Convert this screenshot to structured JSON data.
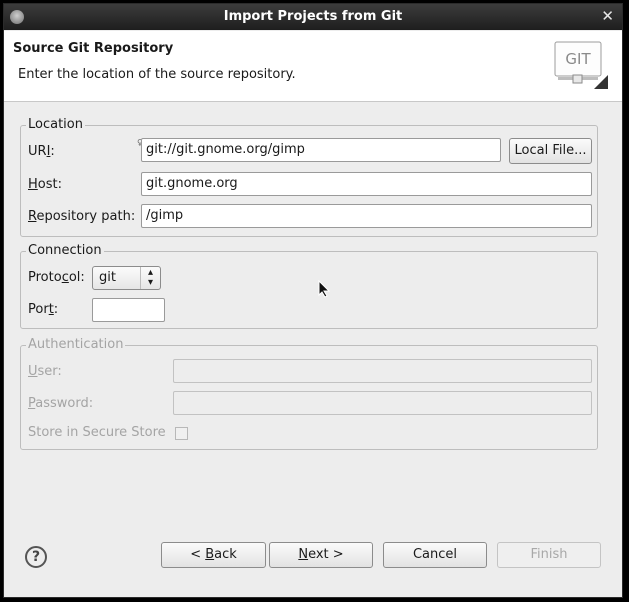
{
  "window": {
    "title": "Import Projects from Git",
    "close_glyph": "✕"
  },
  "header": {
    "title": "Source Git Repository",
    "description": "Enter the location of the source repository.",
    "logo_text": "GIT"
  },
  "location": {
    "group_label": "Location",
    "uri": {
      "label_pre": "UR",
      "label_mnemonic": "I",
      "label_post": ":",
      "value": "git://git.gnome.org/gimp"
    },
    "local_file_button": "Local File...",
    "host": {
      "label_mnemonic": "H",
      "label_post": "ost:",
      "value": "git.gnome.org"
    },
    "repo_path": {
      "label_mnemonic": "R",
      "label_post": "epository path:",
      "value": "/gimp"
    }
  },
  "connection": {
    "group_label": "Connection",
    "protocol": {
      "label_pre": "Proto",
      "label_mnemonic": "c",
      "label_post": "ol:",
      "value": "git"
    },
    "port": {
      "label_pre": "Por",
      "label_mnemonic": "t",
      "label_post": ":",
      "value": ""
    }
  },
  "authentication": {
    "group_label": "Authentication",
    "user": {
      "label_mnemonic": "U",
      "label_post": "ser:",
      "value": ""
    },
    "password": {
      "label_mnemonic": "P",
      "label_post": "assword:",
      "value": ""
    },
    "store_secure": "Store in Secure Store"
  },
  "footer": {
    "back": {
      "pre": "< ",
      "mnemonic": "B",
      "post": "ack"
    },
    "next": {
      "mnemonic": "N",
      "post": "ext >"
    },
    "cancel": "Cancel",
    "finish": "Finish",
    "help_glyph": "?"
  },
  "colors": {
    "titlebar": "#2a2a2a",
    "dialog_bg": "#ededed",
    "header_bg": "#ffffff"
  },
  "icons": {
    "window_menu": "window-menu-icon",
    "help": "help-icon",
    "git_logo": "git-logo-icon"
  }
}
